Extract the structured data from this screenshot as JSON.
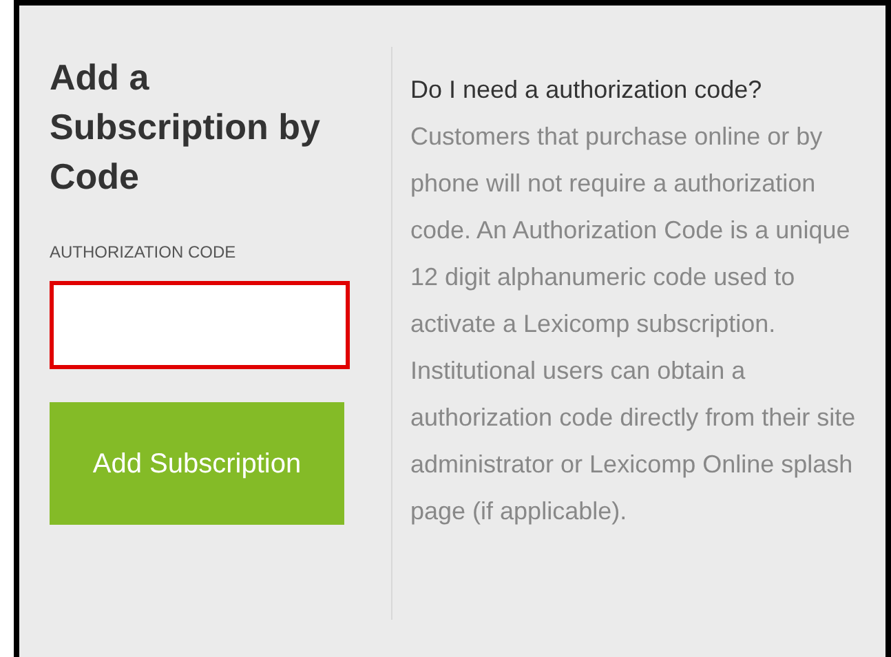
{
  "title": "Add a Subscription by Code",
  "field": {
    "label": "AUTHORIZATION CODE",
    "invalid": true
  },
  "button": "Add Subscription",
  "help": {
    "question": "Do I need a authorization code?",
    "text": "Customers that purchase online or by phone will not require a authorization code. An Authorization Code is a unique 12 digit alphanumeric code used to activate a Lexicomp subscription. Institutional users can obtain a authorization code directly from their site administrator or Lexicomp Online splash page (if applicable)."
  }
}
